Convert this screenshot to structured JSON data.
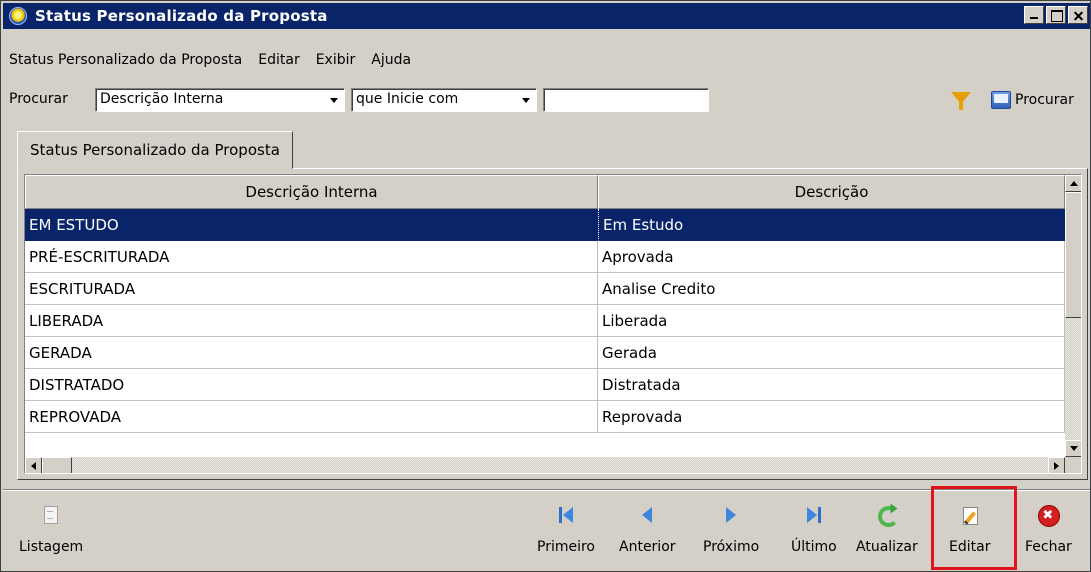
{
  "window": {
    "title": "Status Personalizado da Proposta"
  },
  "menu": {
    "items": [
      "Status Personalizado da Proposta",
      "Editar",
      "Exibir",
      "Ajuda"
    ]
  },
  "search": {
    "label": "Procurar",
    "field": "Descrição Interna",
    "condition": "que Inicie com",
    "value": "",
    "button_label": "Procurar"
  },
  "tab": {
    "label": "Status Personalizado da Proposta"
  },
  "table": {
    "columns": [
      "Descrição Interna",
      "Descrição"
    ],
    "rows": [
      [
        "EM ESTUDO",
        "Em Estudo"
      ],
      [
        "PRÉ-ESCRITURADA",
        "Aprovada"
      ],
      [
        "ESCRITURADA",
        "Analise Credito"
      ],
      [
        "LIBERADA",
        "Liberada"
      ],
      [
        "GERADA",
        "Gerada"
      ],
      [
        "DISTRATADO",
        "Distratada"
      ],
      [
        "REPROVADA",
        "Reprovada"
      ]
    ],
    "selected_row": 0
  },
  "toolbar": {
    "listagem": "Listagem",
    "primeiro": "Primeiro",
    "anterior": "Anterior",
    "proximo": "Próximo",
    "ultimo": "Último",
    "atualizar": "Atualizar",
    "editar": "Editar",
    "fechar": "Fechar"
  },
  "icons": {
    "app": "app-logo-icon",
    "filter": "filter-funnel-icon",
    "search": "search-window-icon",
    "listagem": "document-list-icon",
    "primeiro": "first-record-icon",
    "anterior": "previous-record-icon",
    "proximo": "next-record-icon",
    "ultimo": "last-record-icon",
    "atualizar": "refresh-icon",
    "editar": "edit-document-icon",
    "fechar": "close-red-icon"
  },
  "colors": {
    "titlebar": "#0a246a",
    "selection": "#0a246a",
    "face": "#d4d0c8",
    "highlight": "#e0151c"
  }
}
